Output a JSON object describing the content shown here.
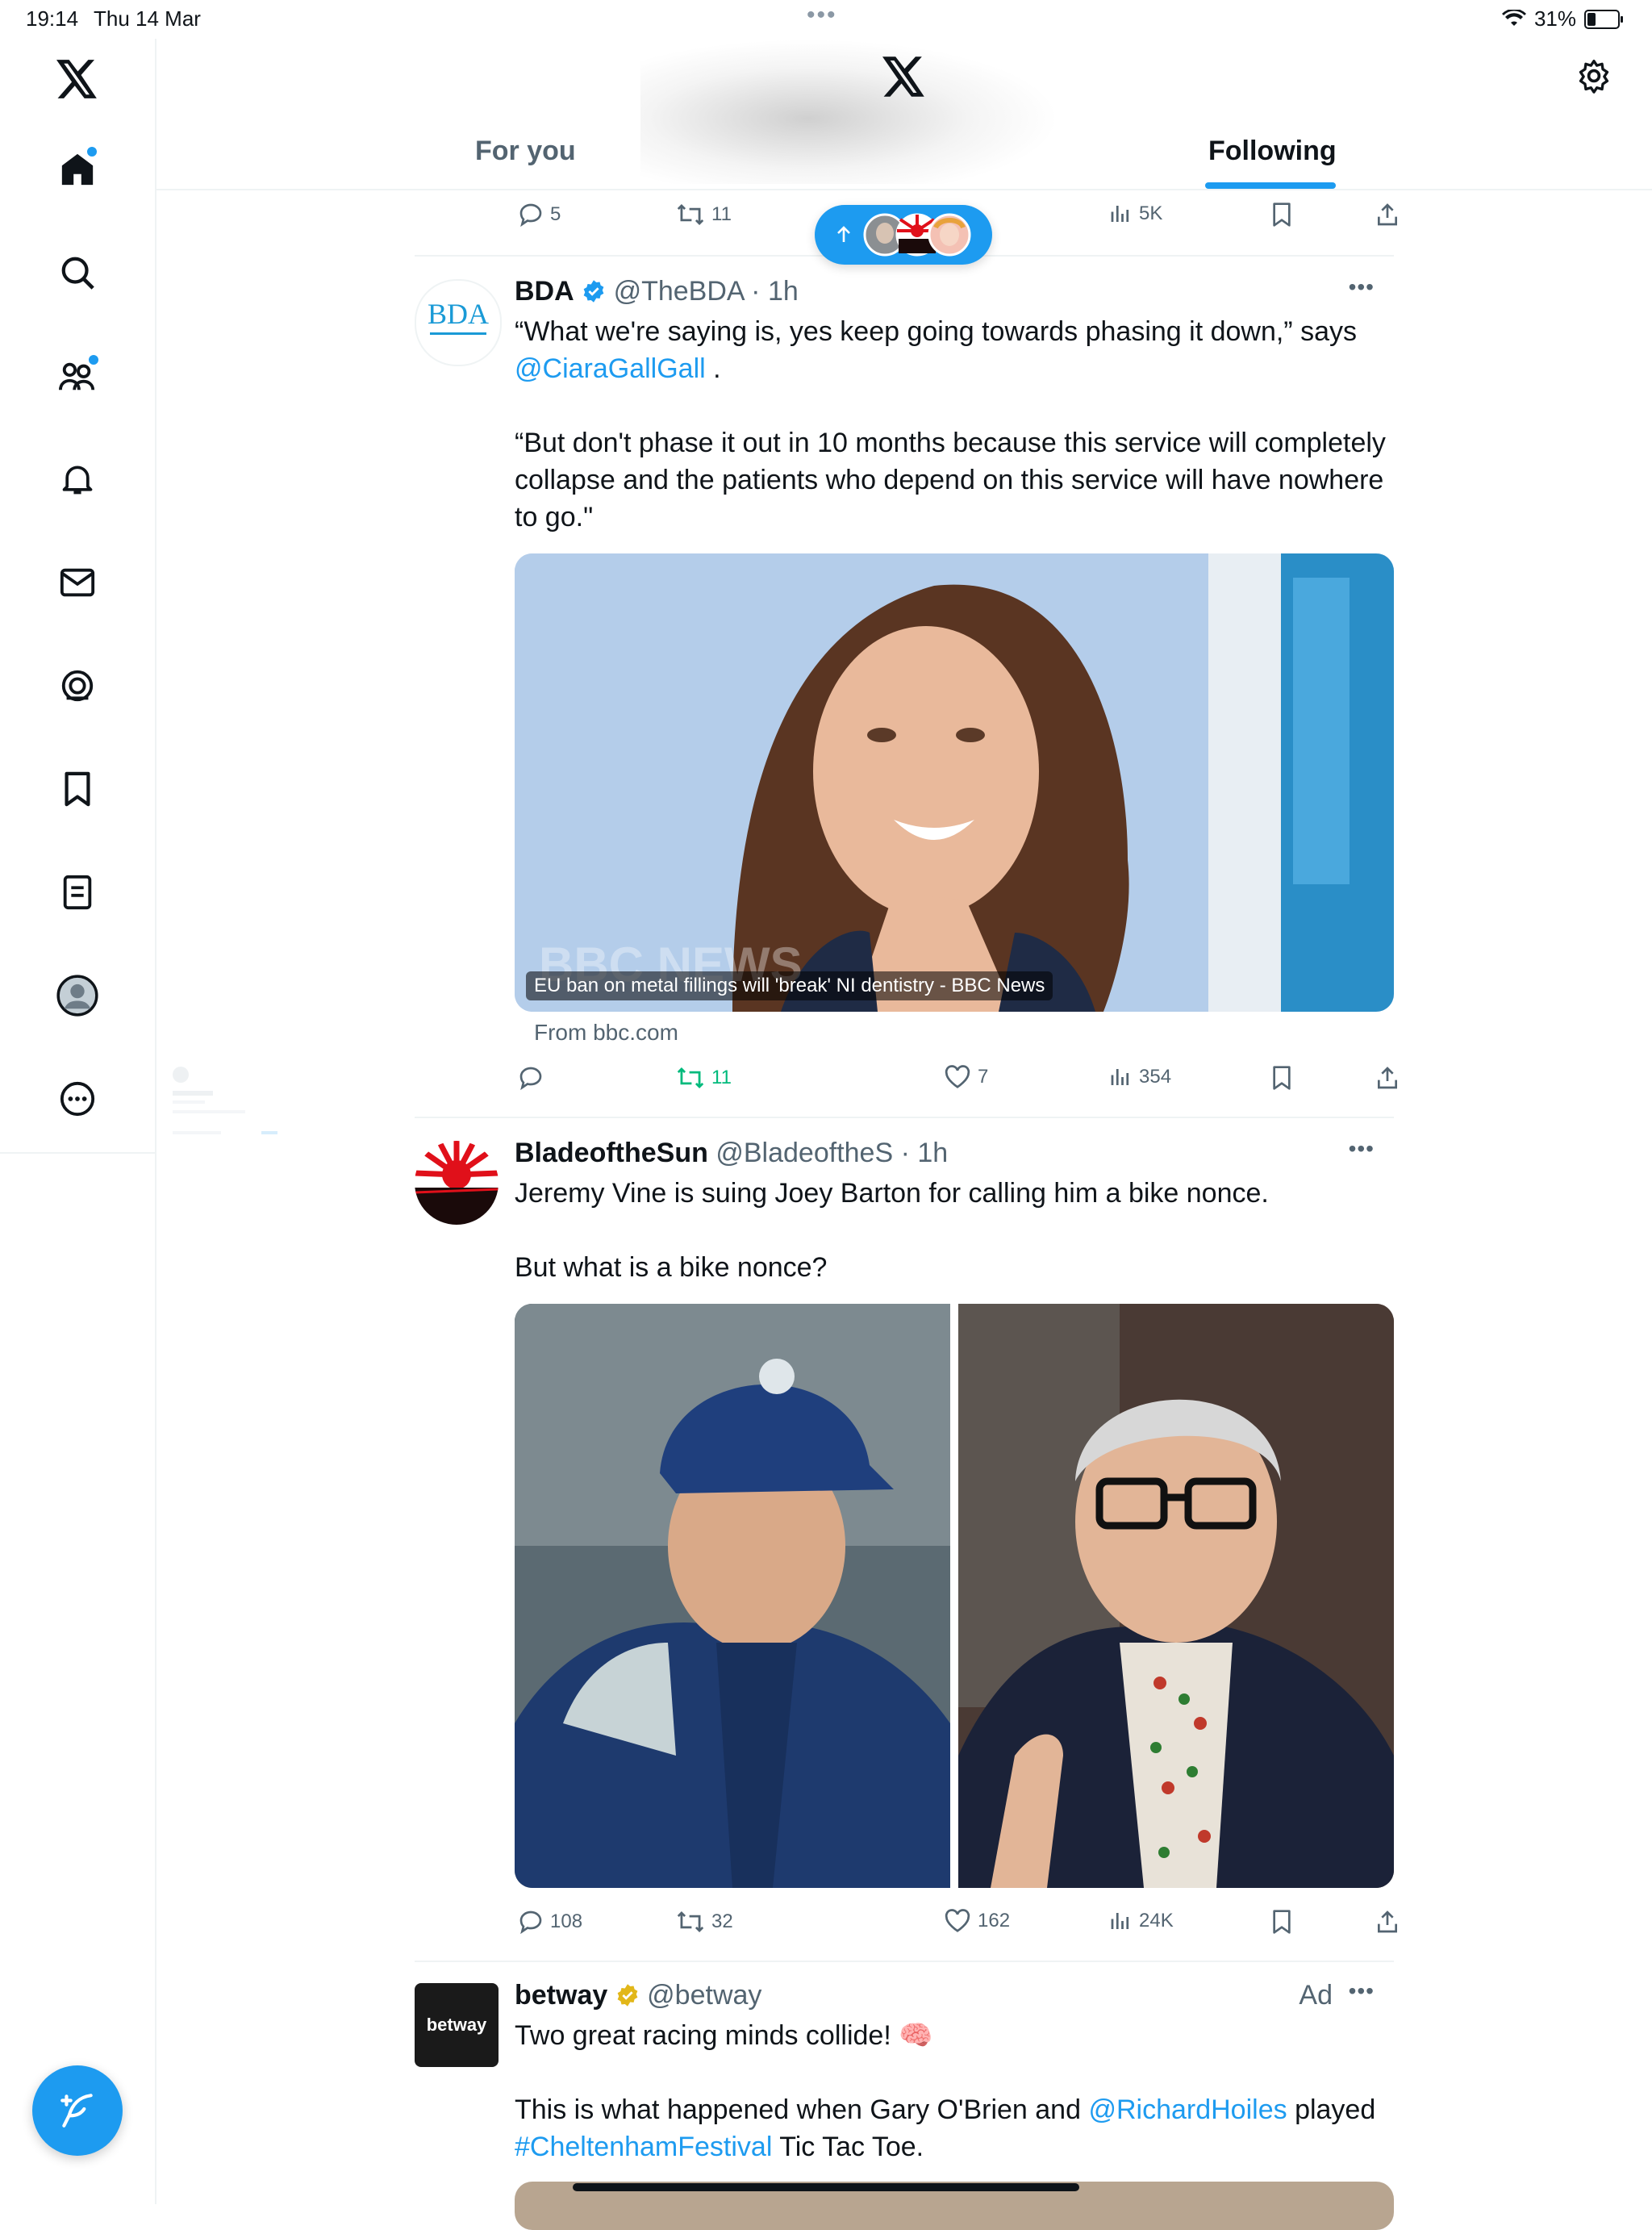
{
  "status_bar": {
    "time": "19:14",
    "date": "Thu 14 Mar",
    "battery": "31%"
  },
  "tabs": {
    "for_you": "For you",
    "following": "Following"
  },
  "prev_tweet_actions": {
    "replies": "5",
    "reposts": "11",
    "views": "5K"
  },
  "tweets": [
    {
      "name": "BDA",
      "handle": "@TheBDA",
      "time": "· 1h",
      "avatar_text": "BDA",
      "text_1": "“What we're saying is, yes keep going towards phasing it down,” says",
      "mention": "@CiaraGallGall",
      "text_1_end": ".",
      "text_2": "“But don't phase it out in 10 months because this service will completely collapse and the patients who depend on this service will have nowhere to go.\"",
      "card_caption": "EU ban on metal fillings will 'break' NI dentistry - BBC News",
      "card_watermark": "BBC NEWS",
      "card_source": "From bbc.com",
      "replies": "",
      "reposts": "11",
      "likes": "7",
      "views": "354"
    },
    {
      "name": "BladeoftheSun",
      "handle": "@BladeoftheS",
      "time": "· 1h",
      "text_1": "Jeremy Vine is suing Joey Barton for calling him a bike nonce.",
      "text_2": "But what is a bike nonce?",
      "replies": "108",
      "reposts": "32",
      "likes": "162",
      "views": "24K"
    },
    {
      "name": "betway",
      "handle": "@betway",
      "ad_label": "Ad",
      "avatar_text": "betway",
      "text_1": "Two great racing minds collide! 🧠",
      "text_2a": "This is what happened when Gary O'Brien and",
      "mention": "@RichardHoiles",
      "text_2b": "played",
      "hashtag": "#CheltenhamFestival",
      "text_2c": "Tic Tac Toe."
    }
  ],
  "colors": {
    "accent": "#1d9bf0",
    "repost_green": "#00ba7c",
    "text": "#0f1419",
    "secondary": "#536471"
  }
}
